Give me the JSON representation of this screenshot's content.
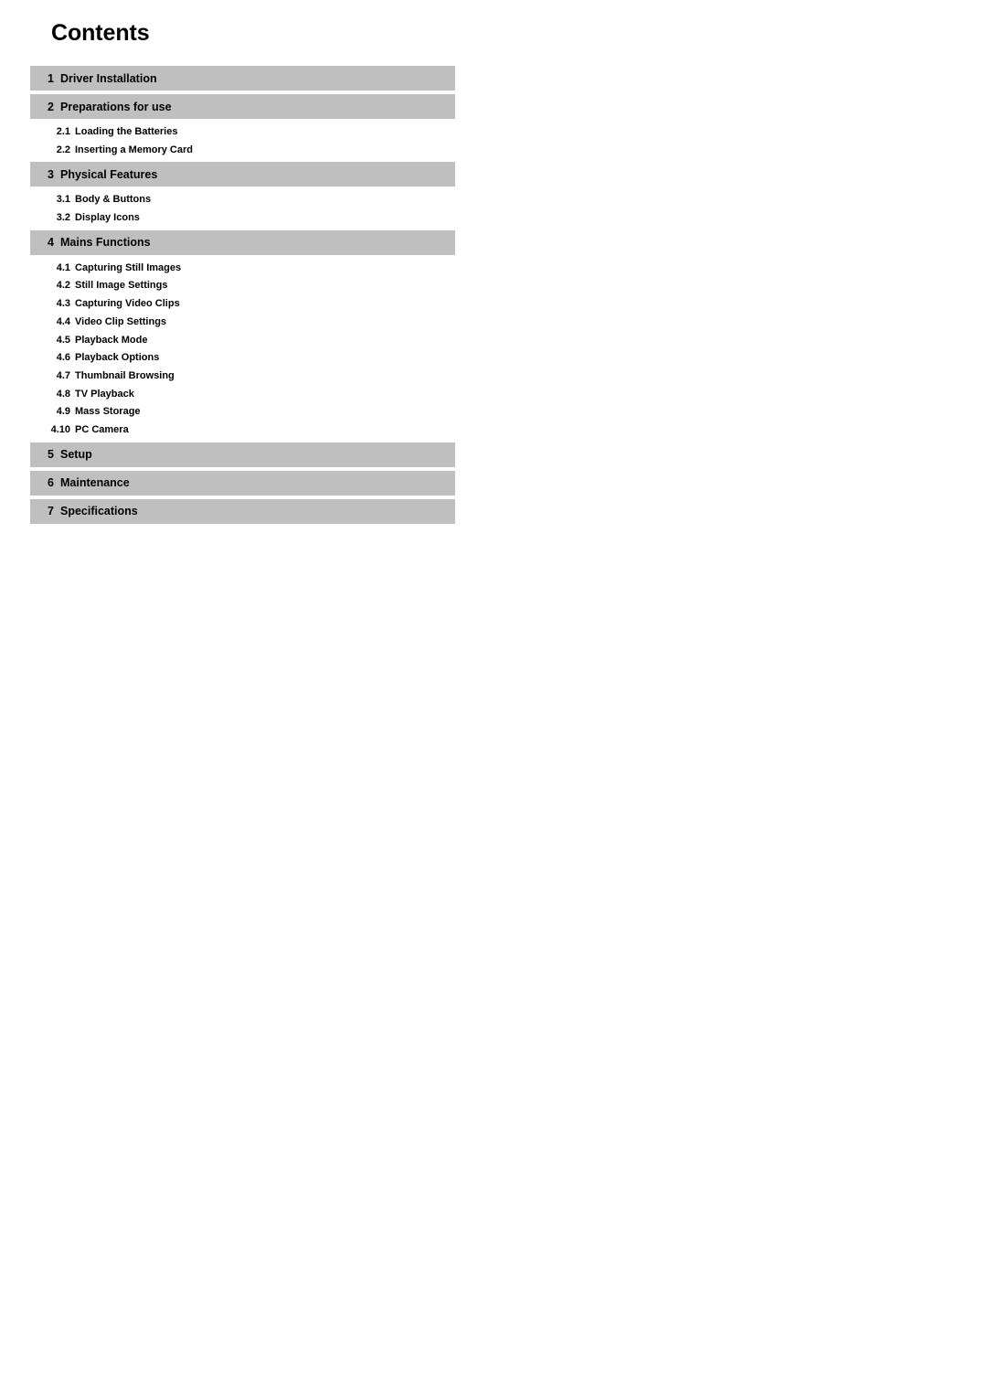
{
  "document": {
    "title": "Contents"
  },
  "colors": {
    "section_bar": "#bfbfbf",
    "text": "#000000",
    "page_background": "#ffffff"
  },
  "toc": {
    "sections": [
      {
        "number": "1",
        "label": "Driver Installation",
        "subsections": []
      },
      {
        "number": "2",
        "label": "Preparations for use",
        "subsections": [
          {
            "number": "2.1",
            "label": "Loading the Batteries"
          },
          {
            "number": "2.2",
            "label": "Inserting a Memory Card"
          }
        ]
      },
      {
        "number": "3",
        "label": "Physical Features",
        "subsections": [
          {
            "number": "3.1",
            "label": "Body & Buttons"
          },
          {
            "number": "3.2",
            "label": "Display Icons"
          }
        ]
      },
      {
        "number": "4",
        "label": "Mains Functions",
        "subsections": [
          {
            "number": "4.1",
            "label": "Capturing Still Images"
          },
          {
            "number": "4.2",
            "label": "Still Image Settings"
          },
          {
            "number": "4.3",
            "label": "Capturing Video Clips"
          },
          {
            "number": "4.4",
            "label": "Video Clip Settings"
          },
          {
            "number": "4.5",
            "label": "Playback Mode"
          },
          {
            "number": "4.6",
            "label": "Playback Options"
          },
          {
            "number": "4.7",
            "label": "Thumbnail Browsing"
          },
          {
            "number": "4.8",
            "label": "TV Playback"
          },
          {
            "number": "4.9",
            "label": "Mass Storage"
          },
          {
            "number": "4.10",
            "label": "PC Camera"
          }
        ]
      },
      {
        "number": "5",
        "label": "Setup",
        "subsections": []
      },
      {
        "number": "6",
        "label": "Maintenance",
        "subsections": []
      },
      {
        "number": "7",
        "label": "Specifications",
        "subsections": []
      }
    ]
  }
}
